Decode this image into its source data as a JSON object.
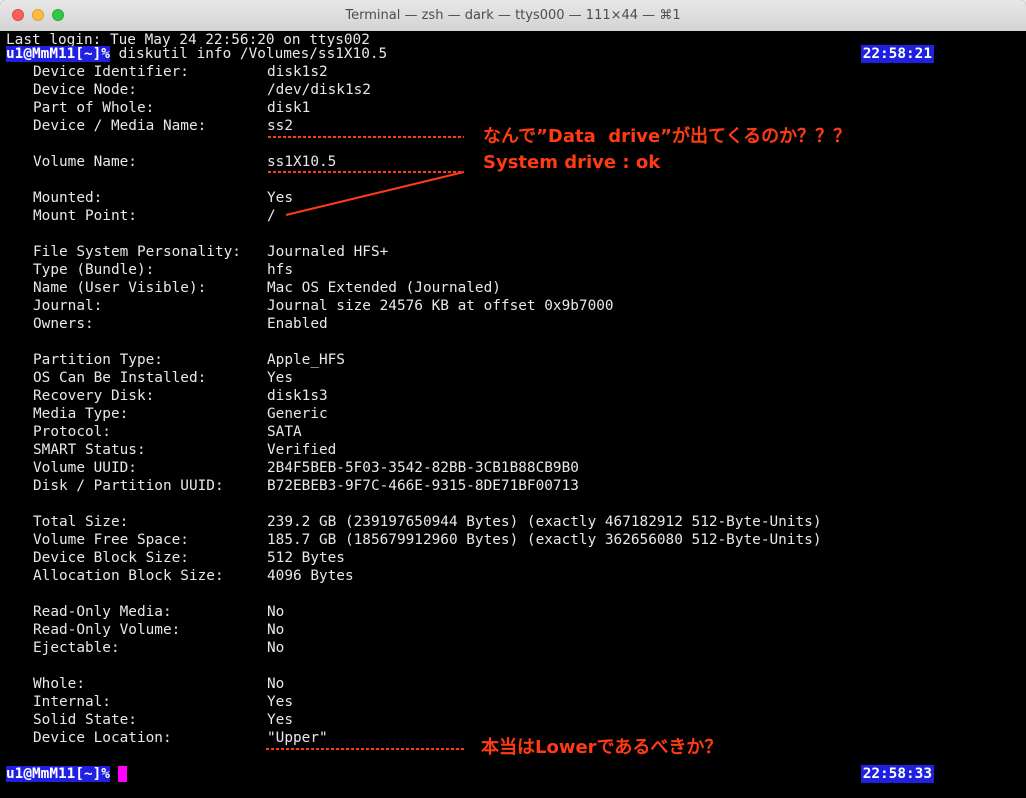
{
  "window": {
    "title": "Terminal — zsh — dark — ttys000 — 111×44 — ⌘1"
  },
  "terminal": {
    "last_login": "Last login: Tue May 24 22:56:20 on ttys002",
    "prompt": "u1@MmM11[~]%",
    "command": " diskutil info /Volumes/ss1X10.5",
    "time_start": "22:58:21",
    "time_end": "22:58:33",
    "fields": [
      {
        "label": "Device Identifier:",
        "value": "disk1s2"
      },
      {
        "label": "Device Node:",
        "value": "/dev/disk1s2"
      },
      {
        "label": "Part of Whole:",
        "value": "disk1"
      },
      {
        "label": "Device / Media Name:",
        "value": "ss2"
      },
      {
        "label": "Volume Name:",
        "value": "ss1X10.5"
      },
      {
        "label": "Mounted:",
        "value": "Yes"
      },
      {
        "label": "Mount Point:",
        "value": "/"
      },
      {
        "label": "File System Personality:",
        "value": "Journaled HFS+"
      },
      {
        "label": "Type (Bundle):",
        "value": "hfs"
      },
      {
        "label": "Name (User Visible):",
        "value": "Mac OS Extended (Journaled)"
      },
      {
        "label": "Journal:",
        "value": "Journal size 24576 KB at offset 0x9b7000"
      },
      {
        "label": "Owners:",
        "value": "Enabled"
      },
      {
        "label": "Partition Type:",
        "value": "Apple_HFS"
      },
      {
        "label": "OS Can Be Installed:",
        "value": "Yes"
      },
      {
        "label": "Recovery Disk:",
        "value": "disk1s3"
      },
      {
        "label": "Media Type:",
        "value": "Generic"
      },
      {
        "label": "Protocol:",
        "value": "SATA"
      },
      {
        "label": "SMART Status:",
        "value": "Verified"
      },
      {
        "label": "Volume UUID:",
        "value": "2B4F5BEB-5F03-3542-82BB-3CB1B88CB9B0"
      },
      {
        "label": "Disk / Partition UUID:",
        "value": "B72EBEB3-9F7C-466E-9315-8DE71BF00713"
      },
      {
        "label": "Total Size:",
        "value": "239.2 GB (239197650944 Bytes) (exactly 467182912 512-Byte-Units)"
      },
      {
        "label": "Volume Free Space:",
        "value": "185.7 GB (185679912960 Bytes) (exactly 362656080 512-Byte-Units)"
      },
      {
        "label": "Device Block Size:",
        "value": "512 Bytes"
      },
      {
        "label": "Allocation Block Size:",
        "value": "4096 Bytes"
      },
      {
        "label": "Read-Only Media:",
        "value": "No"
      },
      {
        "label": "Read-Only Volume:",
        "value": "No"
      },
      {
        "label": "Ejectable:",
        "value": "No"
      },
      {
        "label": "Whole:",
        "value": "No"
      },
      {
        "label": "Internal:",
        "value": "Yes"
      },
      {
        "label": "Solid State:",
        "value": "Yes"
      },
      {
        "label": "Device Location:",
        "value": "\"Upper\""
      }
    ]
  },
  "annotations": {
    "media_name_note": "なんで”Data  drive”が出てくるのか？？？",
    "system_drive_note": "System drive : ok",
    "location_note": "本当はLowerであるべきか？"
  },
  "colors": {
    "annotation": "#ff3b14",
    "prompt_bg": "#2020e0",
    "cursor": "#ff00ff"
  }
}
